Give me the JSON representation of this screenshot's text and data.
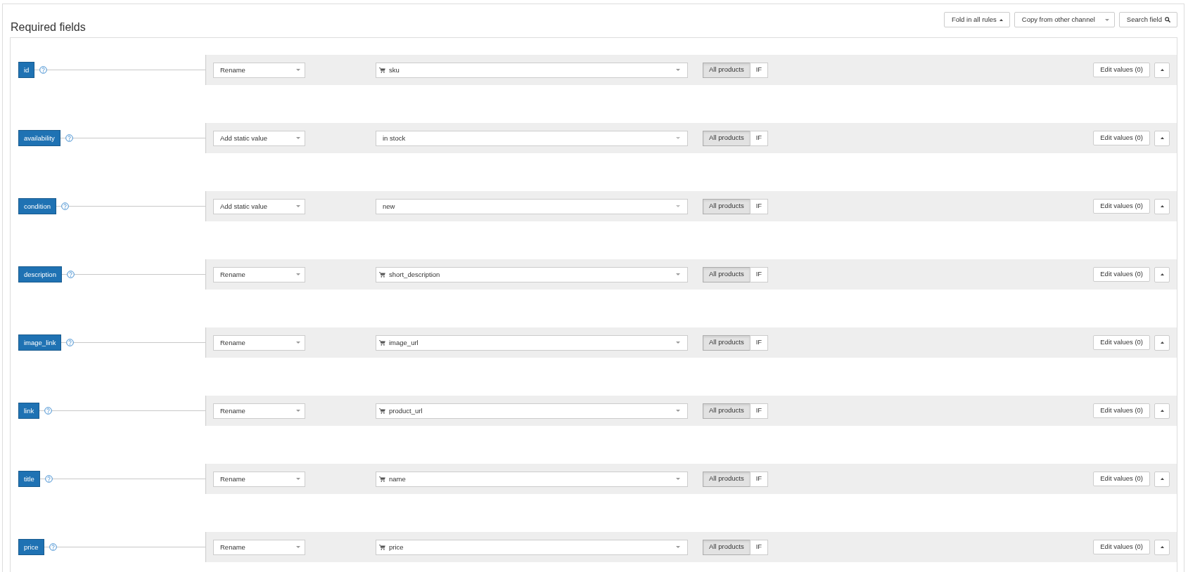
{
  "header": {
    "title": "Required fields",
    "actions": [
      {
        "kind": "fold",
        "label": "Fold in all rules"
      },
      {
        "kind": "dropdown",
        "label": "Copy from other channel"
      },
      {
        "kind": "search",
        "label": "Search field"
      }
    ]
  },
  "rules": [
    {
      "field": "id",
      "method": "Rename",
      "source": {
        "kind": "attribute",
        "value": "sku"
      },
      "scope": [
        {
          "label": "All products",
          "selected": true
        },
        {
          "label": "IF",
          "selected": false
        }
      ],
      "edit": "Edit values (0)"
    },
    {
      "field": "availability",
      "method": "Add static value",
      "source": {
        "kind": "static",
        "value": "in stock"
      },
      "scope": [
        {
          "label": "All products",
          "selected": true
        },
        {
          "label": "IF",
          "selected": false
        }
      ],
      "edit": "Edit values (0)"
    },
    {
      "field": "condition",
      "method": "Add static value",
      "source": {
        "kind": "static",
        "value": "new"
      },
      "scope": [
        {
          "label": "All products",
          "selected": true
        },
        {
          "label": "IF",
          "selected": false
        }
      ],
      "edit": "Edit values (0)"
    },
    {
      "field": "description",
      "method": "Rename",
      "source": {
        "kind": "attribute",
        "value": "short_description"
      },
      "scope": [
        {
          "label": "All products",
          "selected": true
        },
        {
          "label": "IF",
          "selected": false
        }
      ],
      "edit": "Edit values (0)"
    },
    {
      "field": "image_link",
      "method": "Rename",
      "source": {
        "kind": "attribute",
        "value": "image_url"
      },
      "scope": [
        {
          "label": "All products",
          "selected": true
        },
        {
          "label": "IF",
          "selected": false
        }
      ],
      "edit": "Edit values (0)"
    },
    {
      "field": "link",
      "method": "Rename",
      "source": {
        "kind": "attribute",
        "value": "product_url"
      },
      "scope": [
        {
          "label": "All products",
          "selected": true
        },
        {
          "label": "IF",
          "selected": false
        }
      ],
      "edit": "Edit values (0)"
    },
    {
      "field": "title",
      "method": "Rename",
      "source": {
        "kind": "attribute",
        "value": "name"
      },
      "scope": [
        {
          "label": "All products",
          "selected": true
        },
        {
          "label": "IF",
          "selected": false
        }
      ],
      "edit": "Edit values (0)"
    },
    {
      "field": "price",
      "method": "Rename",
      "source": {
        "kind": "attribute",
        "value": "price"
      },
      "scope": [
        {
          "label": "All products",
          "selected": true
        },
        {
          "label": "IF",
          "selected": false
        }
      ],
      "edit": "Edit values (0)"
    }
  ]
}
